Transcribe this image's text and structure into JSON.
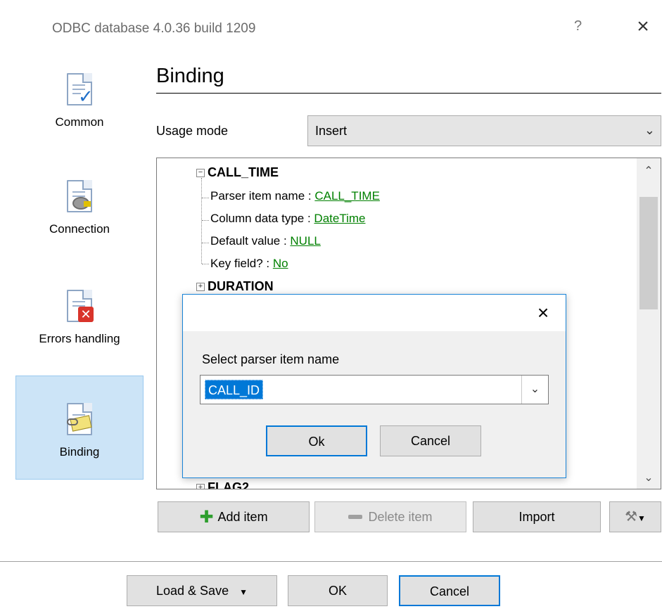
{
  "window": {
    "title": "ODBC database 4.0.36 build 1209",
    "help": "?",
    "close": "×"
  },
  "nav": {
    "items": [
      {
        "label": "Common",
        "icon": "common-doc-icon"
      },
      {
        "label": "Connection",
        "icon": "connection-doc-icon"
      },
      {
        "label": "Errors handling",
        "icon": "errors-doc-icon"
      },
      {
        "label": "Binding",
        "icon": "binding-doc-icon",
        "selected": true
      }
    ]
  },
  "main": {
    "heading": "Binding",
    "usage_label": "Usage mode",
    "usage_value": "Insert",
    "tree": {
      "nodes": [
        {
          "name": "CALL_TIME",
          "expanded": true,
          "children": [
            {
              "key": "Parser item name : ",
              "value": "CALL_TIME"
            },
            {
              "key": "Column data type : ",
              "value": "DateTime"
            },
            {
              "key": "Default value : ",
              "value": "NULL"
            },
            {
              "key": "Key field? : ",
              "value": "No"
            }
          ]
        },
        {
          "name": "DURATION",
          "expanded": false
        },
        {
          "name": "FLAG2",
          "expanded": false
        }
      ]
    },
    "buttons": {
      "add_item": "Add item",
      "delete_item": "Delete item",
      "import": "Import"
    }
  },
  "footer": {
    "load_save": "Load & Save",
    "ok": "OK",
    "cancel": "Cancel"
  },
  "dialog": {
    "close": "×",
    "label": "Select parser item name",
    "value": "CALL_ID",
    "ok": "Ok",
    "cancel": "Cancel"
  },
  "colors": {
    "accent": "#0078d7",
    "link_green": "#008000",
    "nav_selected": "#cce4f7"
  }
}
